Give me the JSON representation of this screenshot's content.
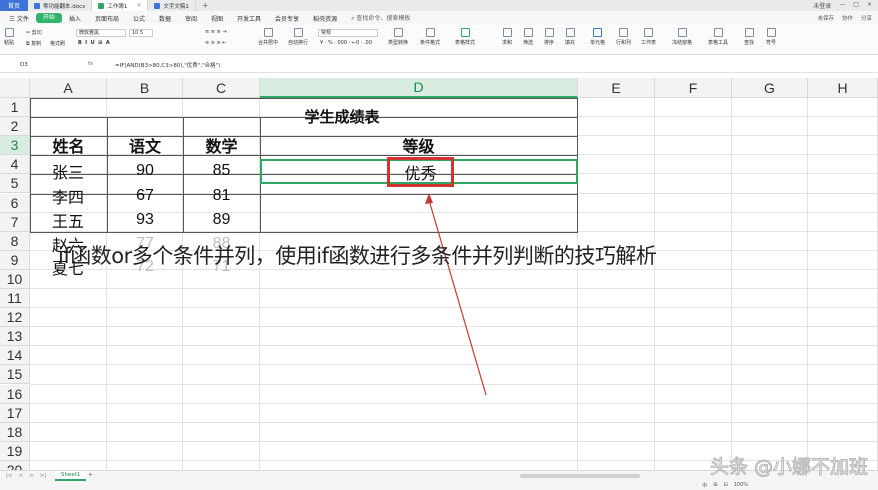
{
  "titlebar": {
    "home": "首页",
    "tabs": [
      {
        "label": "零功能翻本.docx",
        "color": "#3f73d8"
      },
      {
        "label": "工作簿1",
        "color": "#2fa663",
        "active": true
      },
      {
        "label": "文字文稿1",
        "color": "#3f73d8"
      }
    ],
    "right": [
      "未登录",
      "—",
      "□",
      "×"
    ]
  },
  "menu": {
    "items": [
      "三 文件",
      "开始",
      "插入",
      "页面布局",
      "公式",
      "数据",
      "审阅",
      "视图",
      "开发工具",
      "会员专享",
      "稻壳资源"
    ],
    "search": "查找命令、搜索模板",
    "right": [
      "未保存",
      "协作",
      "分享"
    ]
  },
  "ribbon": {
    "font": "微软雅黑",
    "size": "10.5",
    "number_format": "常规",
    "groups": [
      "粘贴",
      "剪切",
      "复制",
      "格式刷",
      "合并居中",
      "自动换行",
      "类型转换",
      "条件格式",
      "表格样式",
      "求和",
      "筛选",
      "排序",
      "填充",
      "单元格",
      "行和列",
      "工作表",
      "冻结窗格",
      "表格工具",
      "查找",
      "符号"
    ]
  },
  "formula_bar": {
    "cell_ref": "D3",
    "fx": "fx",
    "formula": "=IF(AND(B3>80,C3>80),\"优秀\",\"合格\")"
  },
  "columns": [
    "A",
    "B",
    "C",
    "D",
    "E",
    "F",
    "G",
    "H"
  ],
  "rows": [
    "1",
    "2",
    "3",
    "4",
    "5",
    "6",
    "7",
    "8",
    "9",
    "10",
    "11",
    "12",
    "13",
    "14",
    "15",
    "16",
    "17",
    "18",
    "19",
    "20"
  ],
  "table": {
    "title": "学生成绩表",
    "headers": [
      "姓名",
      "语文",
      "数学",
      "等级"
    ],
    "data": [
      [
        "张三",
        "90",
        "85",
        "优秀"
      ],
      [
        "李四",
        "67",
        "81",
        ""
      ],
      [
        "王五",
        "93",
        "89",
        ""
      ],
      [
        "赵六",
        "77",
        "88",
        ""
      ],
      [
        "夏七",
        "72",
        "71",
        ""
      ]
    ]
  },
  "overlay_text": "if函数or多个条件并列，使用if函数进行多条件并列判断的技巧解析",
  "sheet": {
    "nav": [
      "|<",
      "<",
      ">",
      ">|"
    ],
    "tab": "Sheet1",
    "add": "+"
  },
  "status": {
    "right": [
      "中",
      "⊞",
      "⊟",
      "100%"
    ]
  },
  "watermark": "头条 @小娜不加班",
  "colors": {
    "accent": "#2fa663",
    "highlight": "#d1332e",
    "header_bg": "#f3f3f3"
  }
}
